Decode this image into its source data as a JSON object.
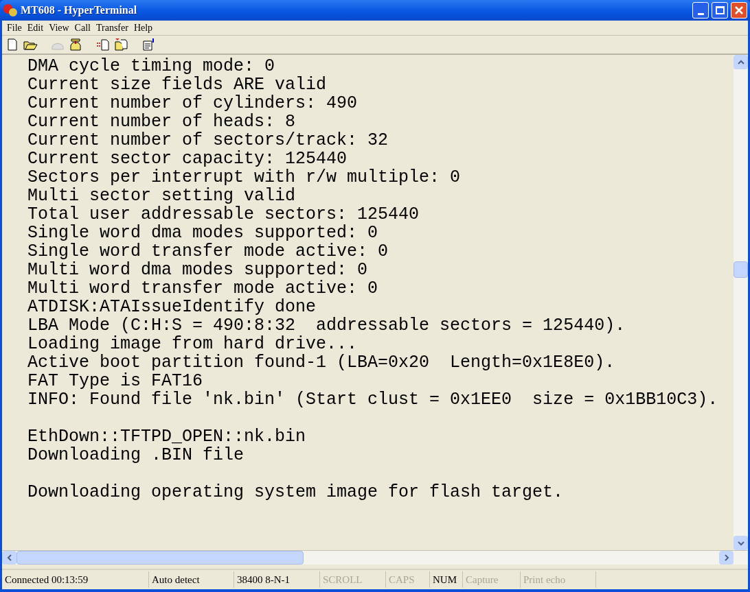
{
  "window": {
    "title": "MT608 - HyperTerminal"
  },
  "menu": [
    "File",
    "Edit",
    "View",
    "Call",
    "Transfer",
    "Help"
  ],
  "toolbar": [
    {
      "kind": "new",
      "disabled": false
    },
    {
      "kind": "open",
      "disabled": false
    },
    {
      "kind": "sep"
    },
    {
      "kind": "disconnect",
      "disabled": true
    },
    {
      "kind": "call",
      "disabled": false
    },
    {
      "kind": "sep"
    },
    {
      "kind": "send",
      "disabled": false
    },
    {
      "kind": "receive",
      "disabled": false
    },
    {
      "kind": "sep"
    },
    {
      "kind": "properties",
      "disabled": false
    }
  ],
  "terminal": {
    "blocks": [
      [
        "DMA cycle timing mode: 0",
        "Current size fields ARE valid",
        "Current number of cylinders: 490",
        "Current number of heads: 8",
        "Current number of sectors/track: 32",
        "Current sector capacity: 125440",
        "Sectors per interrupt with r/w multiple: 0",
        "Multi sector setting valid",
        "Total user addressable sectors: 125440",
        "Single word dma modes supported: 0",
        "Single word transfer mode active: 0",
        "Multi word dma modes supported: 0",
        "Multi word transfer mode active: 0",
        "ATDISK:ATAIssueIdentify done",
        "LBA Mode (C:H:S = 490:8:32  addressable sectors = 125440).",
        "Loading image from hard drive...",
        "Active boot partition found-1 (LBA=0x20  Length=0x1E8E0).",
        "FAT Type is FAT16",
        "INFO: Found file 'nk.bin' (Start clust = 0x1EE0  size = 0x1BB10C3)."
      ],
      [
        "EthDown::TFTPD_OPEN::nk.bin",
        "Downloading .BIN file"
      ],
      [
        "Downloading operating system image for flash target."
      ]
    ]
  },
  "status_bar": [
    {
      "text": "Connected 00:13:59",
      "disabled": false
    },
    {
      "text": "Auto detect",
      "disabled": false
    },
    {
      "text": "38400 8-N-1",
      "disabled": false
    },
    {
      "text": "SCROLL",
      "disabled": true
    },
    {
      "text": "CAPS",
      "disabled": true
    },
    {
      "text": "NUM",
      "disabled": false
    },
    {
      "text": "Capture",
      "disabled": true
    },
    {
      "text": "Print echo",
      "disabled": true
    }
  ]
}
